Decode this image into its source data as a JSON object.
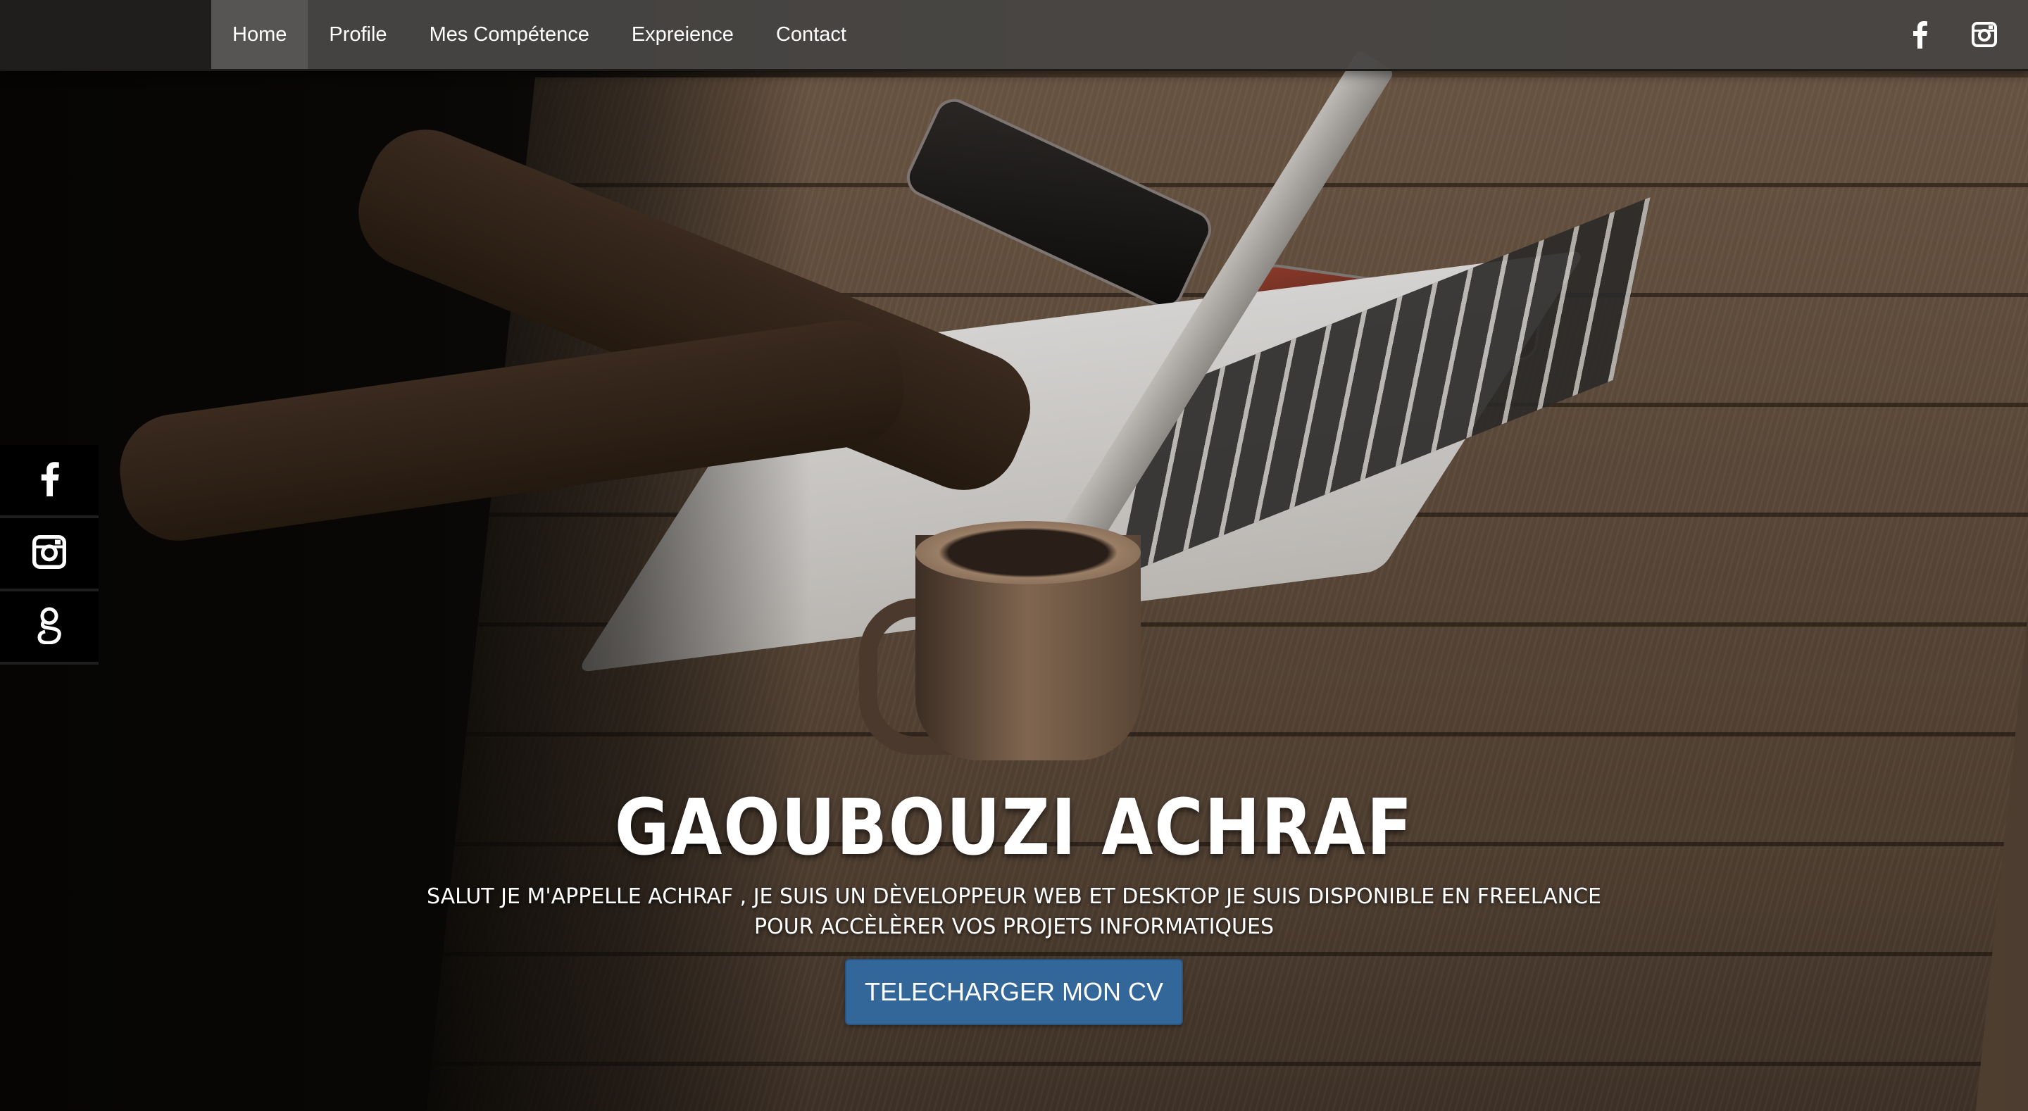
{
  "nav": {
    "items": [
      {
        "label": "Home",
        "active": true
      },
      {
        "label": "Profile",
        "active": false
      },
      {
        "label": "Mes Compétence",
        "active": false
      },
      {
        "label": "Expreience",
        "active": false
      },
      {
        "label": "Contact",
        "active": false
      }
    ],
    "social_icons": [
      "facebook-icon",
      "instagram-icon"
    ]
  },
  "side_social": {
    "icons": [
      "facebook-icon",
      "instagram-icon",
      "google-icon"
    ]
  },
  "hero": {
    "title": "GAOUBOUZI ACHRAF",
    "subtitle_line1": "SALUT JE M'APPELLE ACHRAF , JE SUIS UN DÈVELOPPEUR WEB ET DESKTOP JE SUIS DISPONIBLE EN FREELANCE",
    "subtitle_line2": "POUR ACCÈLÈRER VOS PROJETS INFORMATIQUES",
    "button_label": "TELECHARGER MON CV"
  },
  "colors": {
    "nav_bg": "#484644",
    "button_bg": "#336699",
    "text": "#ffffff"
  }
}
